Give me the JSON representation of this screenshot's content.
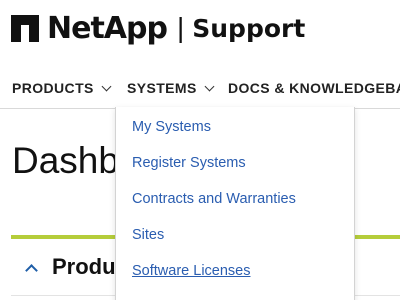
{
  "brand": {
    "name": "NetApp",
    "separator": "|",
    "suffix": "Support"
  },
  "nav": {
    "items": [
      {
        "label": "PRODUCTS",
        "icon": "chevron-down-icon"
      },
      {
        "label": "SYSTEMS",
        "icon": "chevron-down-icon"
      },
      {
        "label": "DOCS & KNOWLEDGEBASE",
        "icon": "chevron-down-icon"
      }
    ]
  },
  "dropdown": {
    "open_menu": "SYSTEMS",
    "items": [
      {
        "label": "My Systems"
      },
      {
        "label": "Register Systems"
      },
      {
        "label": "Contracts and Warranties"
      },
      {
        "label": "Sites"
      },
      {
        "label": "Software Licenses",
        "hovered": true
      }
    ]
  },
  "main": {
    "title": "Dashboard",
    "panel_title": "Products",
    "panel_icon": "chevron-up-icon"
  },
  "colors": {
    "link": "#2a5db0",
    "accent_green": "#b5cd3a",
    "caret": "#1f5ea8"
  }
}
